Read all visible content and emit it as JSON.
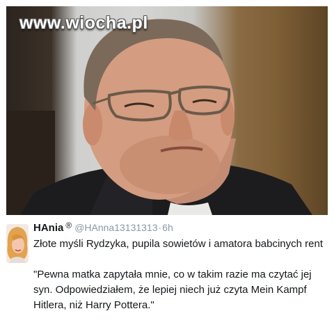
{
  "watermark": "www.wiocha.pl",
  "tweet": {
    "author_name": "HAnia",
    "badge": "®",
    "handle": "@HAnna13131313",
    "separator": "·",
    "time": "6h",
    "line1": "Złote myśli Rydzyka, pupila sowietów i amatora babcinych rent",
    "quote": "\"Pewna matka zapytała mnie, co w takim razie ma czytać jej syn. Odpowiedziałem, że lepiej niech już czyta Mein Kampf  Hitlera, niż Harry Pottera.\""
  },
  "colors": {
    "text": "#14171a",
    "secondary": "#8899a6",
    "background": "#ffffff"
  },
  "icons": {
    "badge": "registered-mark"
  }
}
